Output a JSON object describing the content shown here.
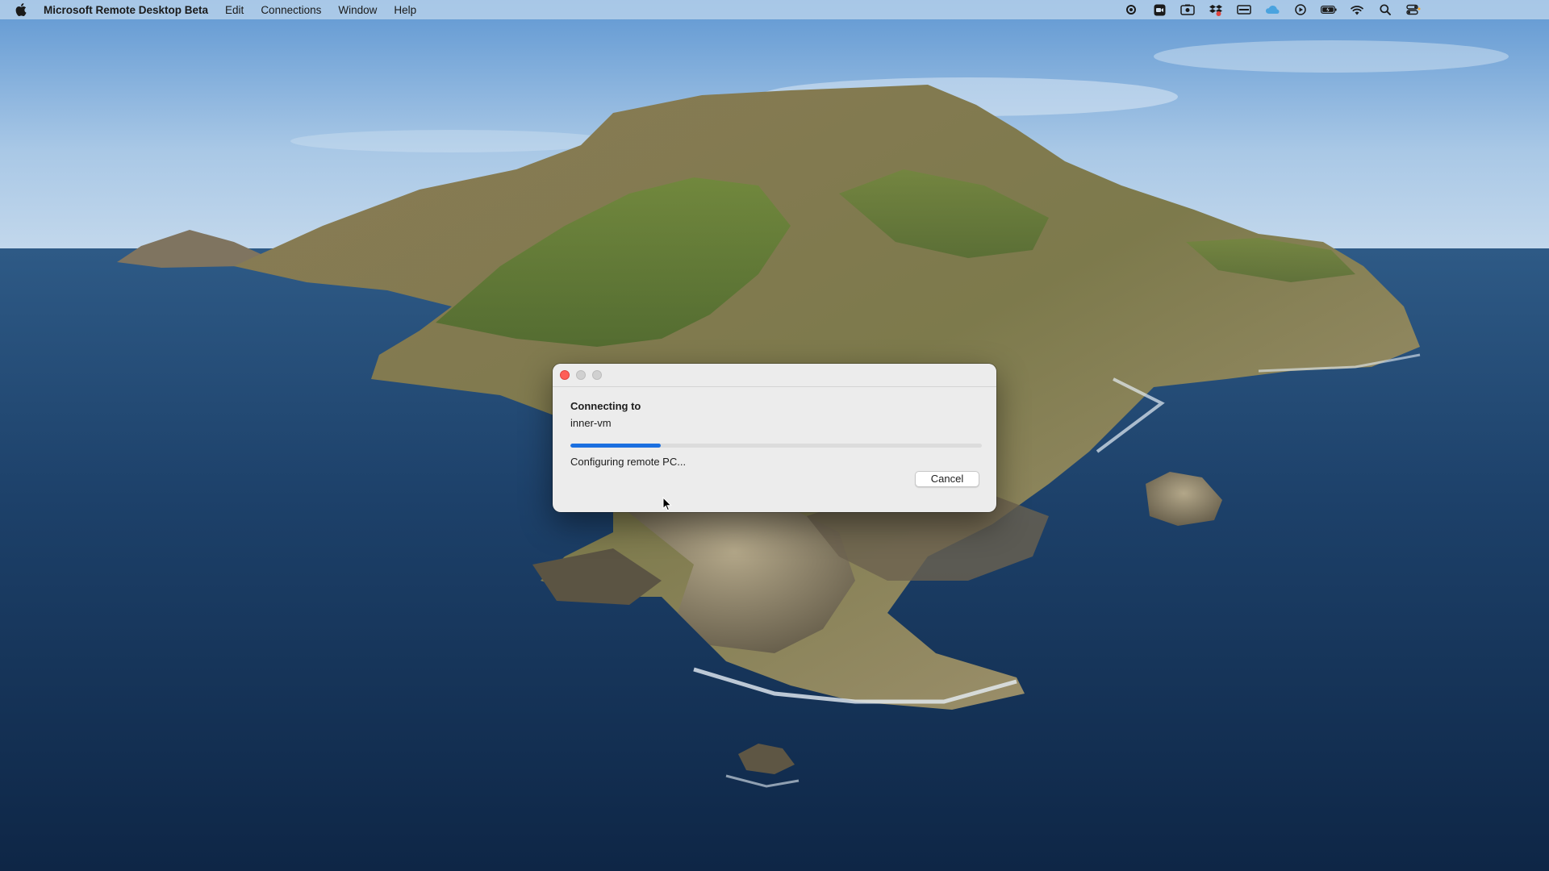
{
  "menubar": {
    "app_name": "Microsoft Remote Desktop Beta",
    "items": [
      "Edit",
      "Connections",
      "Window",
      "Help"
    ],
    "status_icons": [
      "settings-gear-icon",
      "zoom-icon",
      "screen-capture-icon",
      "dropbox-icon",
      "display-icon",
      "creative-cloud-icon",
      "play-icon",
      "battery-icon",
      "wifi-icon",
      "search-icon",
      "control-center-icon"
    ]
  },
  "dialog": {
    "heading": "Connecting to",
    "host": "inner-vm",
    "progress": 0.22,
    "status": "Configuring remote PC...",
    "cancel_label": "Cancel"
  },
  "colors": {
    "accent": "#1b6fe0",
    "close": "#fe5f57"
  }
}
